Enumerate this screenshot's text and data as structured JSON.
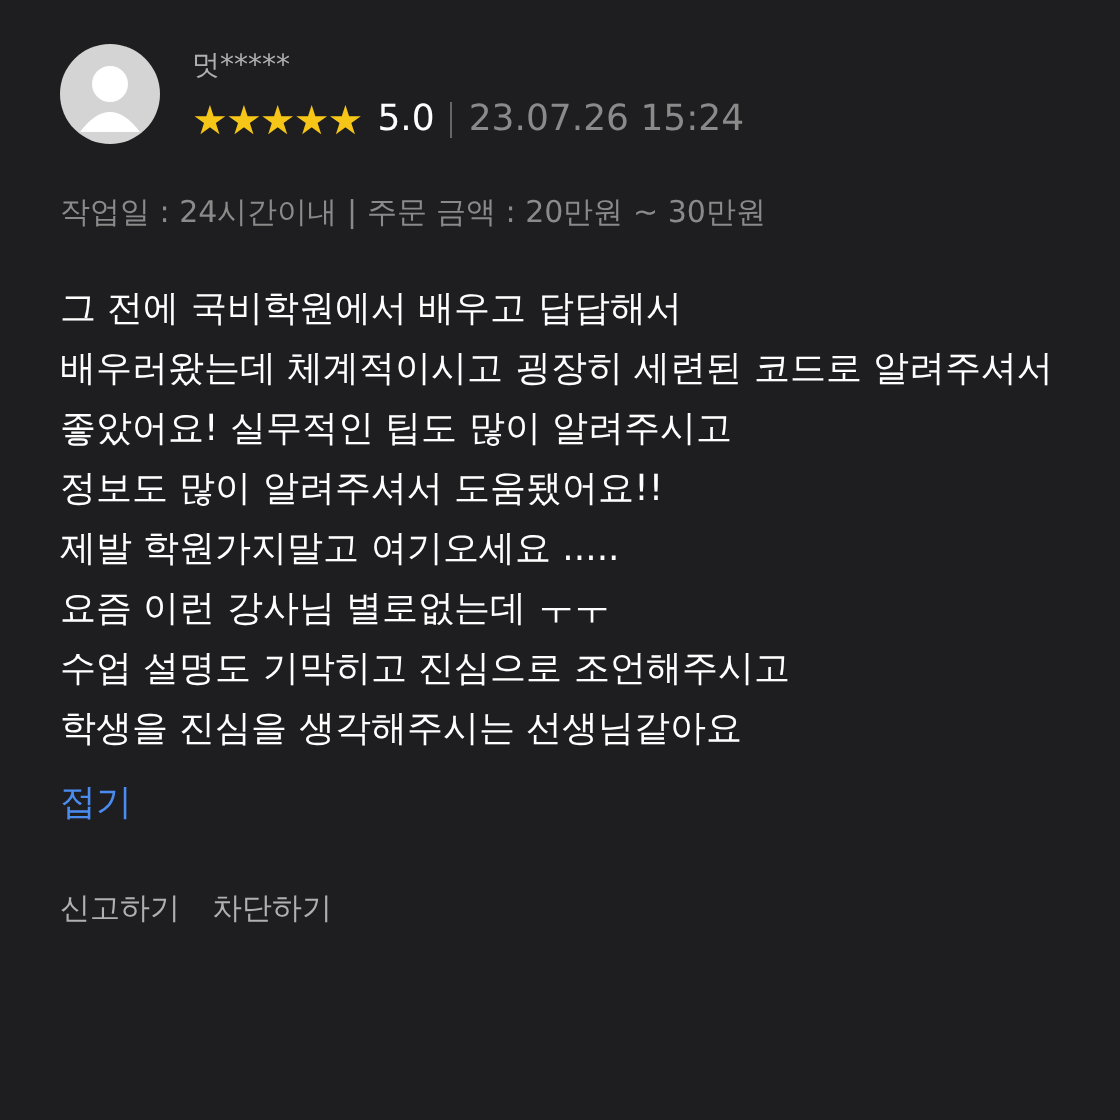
{
  "review": {
    "author": "멋*****",
    "stars": 5,
    "rating": "5.0",
    "date": "23.07.26 15:24",
    "meta": "작업일 : 24시간이내 | 주문 금액 : 20만원 ~ 30만원",
    "lines": [
      "그 전에 국비학원에서 배우고 답답해서",
      "배우러왔는데 체계적이시고 굉장히 세련된 코드로 알려주셔서",
      "좋았어요! 실무적인 팁도 많이 알려주시고",
      "정보도 많이 알려주셔서 도움됐어요!!",
      "제발 학원가지말고 여기오세요 .....",
      "요즘 이런 강사님 별로없는데 ㅜㅜ",
      "수업 설명도 기막히고 진심으로 조언해주시고",
      "학생을 진심을 생각해주시는 선생님같아요"
    ],
    "collapse": "접기",
    "actions": [
      "신고하기",
      "차단하기"
    ]
  }
}
